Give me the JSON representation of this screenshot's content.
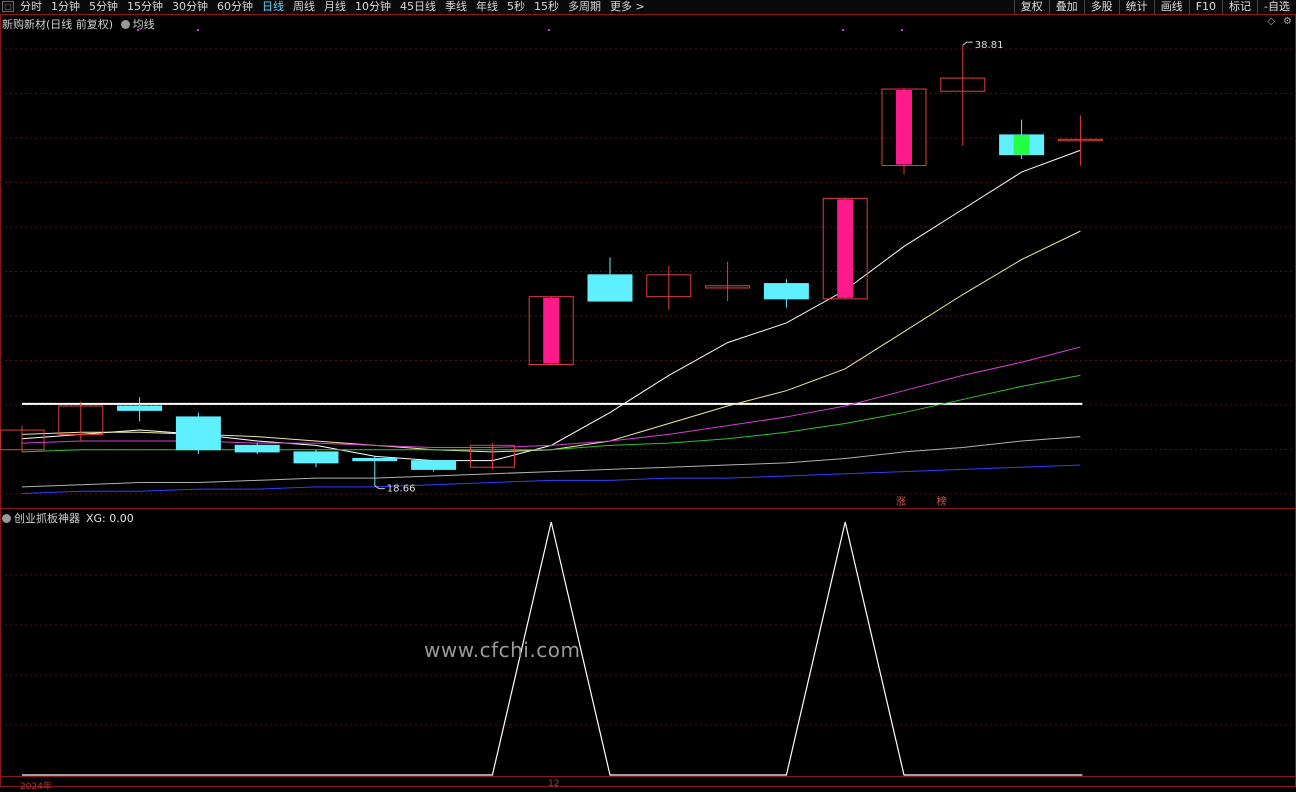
{
  "toolbar": {
    "timeframes": [
      "分时",
      "1分钟",
      "5分钟",
      "15分钟",
      "30分钟",
      "60分钟",
      "日线",
      "周线",
      "月线",
      "10分钟",
      "45日线",
      "季线",
      "年线",
      "5秒",
      "15秒",
      "多周期",
      "更多 >"
    ],
    "active_timeframe": "日线",
    "right_tools": [
      "复权",
      "叠加",
      "多股",
      "统计",
      "画线",
      "F10",
      "标记",
      "-自选"
    ]
  },
  "main_panel": {
    "stock_title": "新购新材(日线 前复权)",
    "indicator_name": "均线",
    "high_label": "38.81",
    "low_label": "18.66",
    "signal_markers": [
      "涨",
      "榜"
    ]
  },
  "sub_panel": {
    "indicator_name": "创业抓板神器",
    "indicator_value": "XG: 0.00"
  },
  "watermark": "www.cfchi.com",
  "date_labels": {
    "left": "2024年",
    "mid": "12"
  },
  "colors": {
    "up_candle": "#ff1a8c",
    "down_candle": "#5ef0ff",
    "green_candle": "#22ff44",
    "grid_red": "#5a1010",
    "ma_white": "#ffffff",
    "ma_yellow": "#f0e8a0",
    "ma_magenta": "#d040d0",
    "ma_green": "#30c030",
    "ma_grey": "#b0b0b0",
    "ma_blue": "#3040ff"
  },
  "chart_data": {
    "type": "candlestick",
    "price_high_label": 38.81,
    "price_low_label": 18.66,
    "candles": [
      {
        "o": 20.3,
        "c": 21.2,
        "h": 21.4,
        "l": 20.2
      },
      {
        "o": 21.0,
        "c": 22.3,
        "h": 22.5,
        "l": 20.7
      },
      {
        "o": 22.3,
        "c": 22.1,
        "h": 22.7,
        "l": 21.6
      },
      {
        "o": 21.8,
        "c": 20.3,
        "h": 22.0,
        "l": 20.1
      },
      {
        "o": 20.5,
        "c": 20.2,
        "h": 20.6,
        "l": 20.1
      },
      {
        "o": 20.2,
        "c": 19.7,
        "h": 20.3,
        "l": 19.5
      },
      {
        "o": 19.9,
        "c": 19.8,
        "h": 20.0,
        "l": 18.66
      },
      {
        "o": 19.8,
        "c": 19.4,
        "h": 19.8,
        "l": 19.3
      },
      {
        "o": 19.5,
        "c": 20.5,
        "h": 20.6,
        "l": 19.4
      },
      {
        "o": 24.2,
        "c": 27.3,
        "h": 27.3,
        "l": 24.2
      },
      {
        "o": 28.3,
        "c": 27.1,
        "h": 29.1,
        "l": 27.1
      },
      {
        "o": 27.3,
        "c": 28.3,
        "h": 28.7,
        "l": 26.7
      },
      {
        "o": 27.7,
        "c": 27.8,
        "h": 28.9,
        "l": 27.1
      },
      {
        "o": 27.9,
        "c": 27.2,
        "h": 28.1,
        "l": 26.8
      },
      {
        "o": 27.2,
        "c": 31.8,
        "h": 31.8,
        "l": 27.2
      },
      {
        "o": 33.3,
        "c": 36.8,
        "h": 36.8,
        "l": 32.9
      },
      {
        "o": 36.7,
        "c": 37.3,
        "h": 38.81,
        "l": 34.2
      },
      {
        "o": 34.7,
        "c": 33.8,
        "h": 35.4,
        "l": 33.6
      },
      {
        "o": 34.5,
        "c": 34.5,
        "h": 35.6,
        "l": 33.3
      }
    ],
    "ma_lines": [
      {
        "name": "MA5",
        "values": [
          20.8,
          21.0,
          21.2,
          21.0,
          20.7,
          20.5,
          20.0,
          19.8,
          19.8,
          20.5,
          22.0,
          23.7,
          25.2,
          26.1,
          27.6,
          29.6,
          31.3,
          33.0,
          34.0
        ]
      },
      {
        "name": "MA10",
        "values": [
          21.0,
          21.1,
          21.1,
          21.0,
          20.9,
          20.7,
          20.5,
          20.3,
          20.2,
          20.3,
          20.7,
          21.5,
          22.3,
          23.0,
          24.0,
          25.7,
          27.4,
          29.0,
          30.3
        ]
      },
      {
        "name": "MA20",
        "values": [
          20.6,
          20.7,
          20.7,
          20.7,
          20.6,
          20.6,
          20.5,
          20.4,
          20.4,
          20.5,
          20.7,
          21.0,
          21.4,
          21.8,
          22.3,
          23.0,
          23.7,
          24.3,
          25.0
        ]
      },
      {
        "name": "MA30",
        "values": [
          20.2,
          20.3,
          20.3,
          20.3,
          20.3,
          20.3,
          20.3,
          20.3,
          20.3,
          20.3,
          20.5,
          20.6,
          20.8,
          21.1,
          21.5,
          22.0,
          22.6,
          23.2,
          23.7
        ]
      },
      {
        "name": "MA60",
        "values": [
          18.6,
          18.7,
          18.8,
          18.8,
          18.9,
          19.0,
          19.0,
          19.1,
          19.2,
          19.3,
          19.4,
          19.5,
          19.6,
          19.7,
          19.9,
          20.2,
          20.4,
          20.7,
          20.9
        ]
      },
      {
        "name": "MA120",
        "values": [
          18.3,
          18.4,
          18.4,
          18.5,
          18.5,
          18.6,
          18.6,
          18.7,
          18.8,
          18.9,
          18.9,
          19.0,
          19.0,
          19.1,
          19.2,
          19.3,
          19.4,
          19.5,
          19.6
        ]
      }
    ],
    "horizontal_level": 22.4,
    "xg_signal": [
      0,
      0,
      0,
      0,
      0,
      0,
      0,
      0,
      0,
      1,
      0,
      0,
      0,
      0,
      1,
      0,
      0,
      0,
      0
    ]
  }
}
